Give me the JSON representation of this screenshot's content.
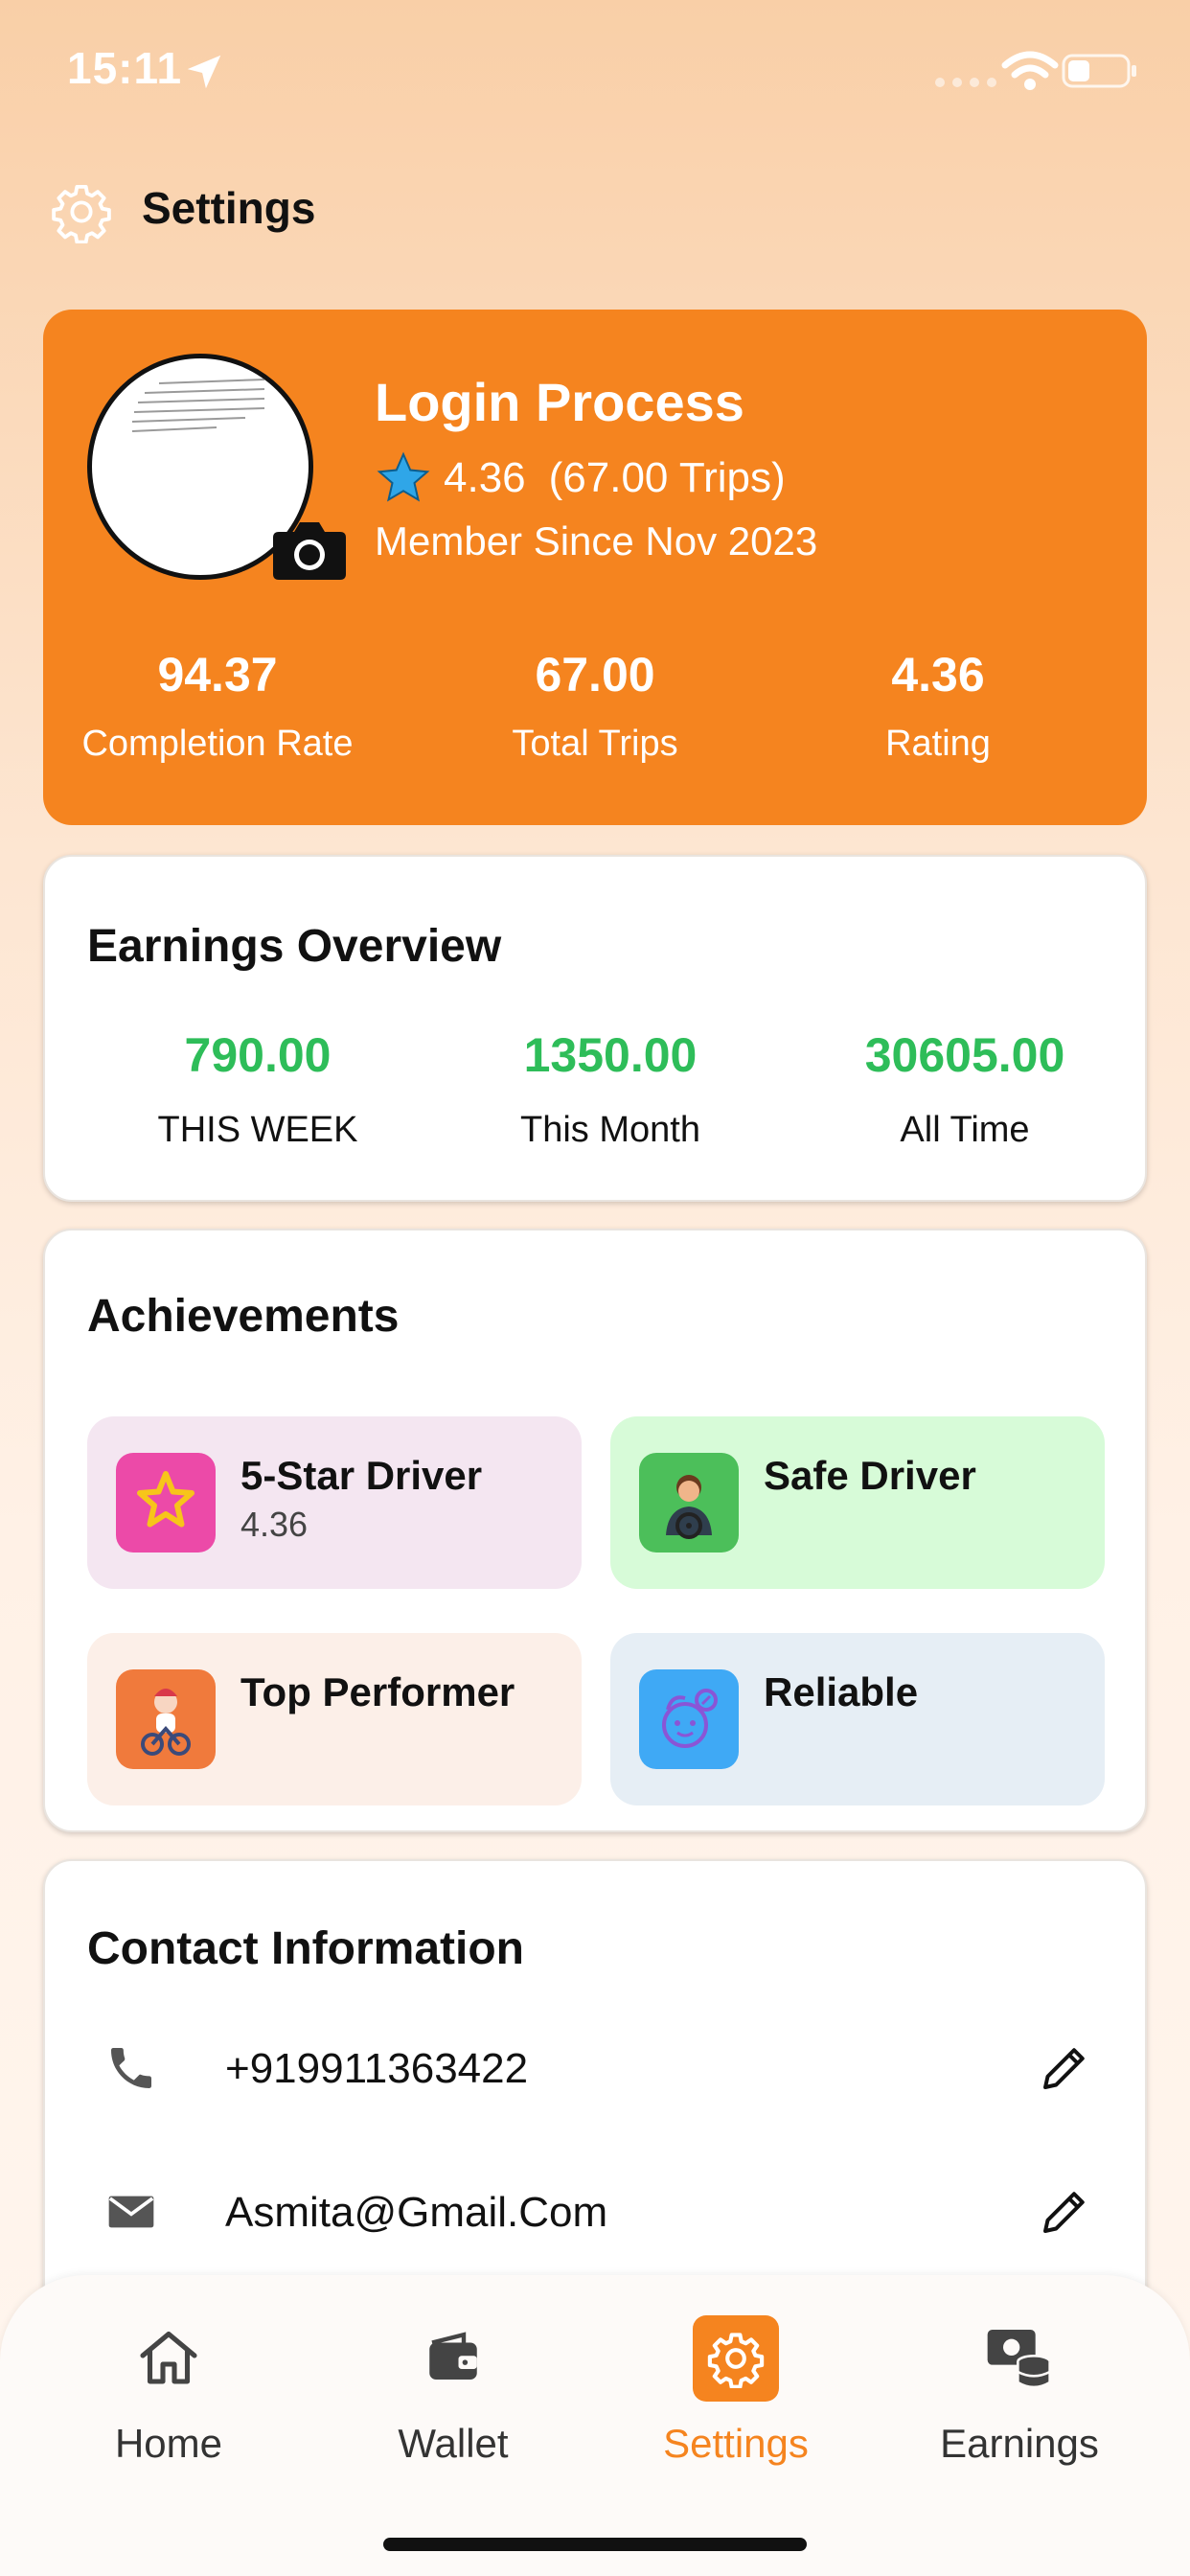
{
  "status_bar": {
    "time": "15:11"
  },
  "header": {
    "title": "Settings"
  },
  "profile": {
    "name": "Login Process",
    "rating": "4.36",
    "trips": "(67.00 Trips)",
    "member_since": "Member Since Nov 2023",
    "stats": [
      {
        "value": "94.37",
        "label": "Completion Rate"
      },
      {
        "value": "67.00",
        "label": "Total Trips"
      },
      {
        "value": "4.36",
        "label": "Rating"
      }
    ]
  },
  "earnings": {
    "title": "Earnings Overview",
    "items": [
      {
        "value": "790.00",
        "label": "THIS WEEK"
      },
      {
        "value": "1350.00",
        "label": "This Month"
      },
      {
        "value": "30605.00",
        "label": "All Time"
      }
    ]
  },
  "achievements": {
    "title": "Achievements",
    "items": [
      {
        "title": "5-Star Driver",
        "subtitle": "4.36",
        "icon": "star-badge-icon",
        "bg": "#f4e6f1",
        "icon_bg": "#ec4aa8"
      },
      {
        "title": "Safe Driver",
        "subtitle": "",
        "icon": "driver-icon",
        "bg": "#d7fbd8",
        "icon_bg": "#4cbf5a"
      },
      {
        "title": "Top Performer",
        "subtitle": "",
        "icon": "performer-icon",
        "bg": "#fcefe8",
        "icon_bg": "#f07a3c"
      },
      {
        "title": "Reliable",
        "subtitle": "",
        "icon": "reliable-icon",
        "bg": "#e6eef5",
        "icon_bg": "#3fa9f5"
      }
    ]
  },
  "contact": {
    "title": "Contact Information",
    "phone": "+919911363422",
    "email": "Asmita@Gmail.Com"
  },
  "nav": {
    "items": [
      {
        "label": "Home",
        "icon": "home-icon"
      },
      {
        "label": "Wallet",
        "icon": "wallet-icon"
      },
      {
        "label": "Settings",
        "icon": "gear-icon",
        "active": true
      },
      {
        "label": "Earnings",
        "icon": "earnings-icon"
      }
    ]
  },
  "colors": {
    "accent": "#f5841f",
    "earnings_green": "#2ebd59"
  }
}
